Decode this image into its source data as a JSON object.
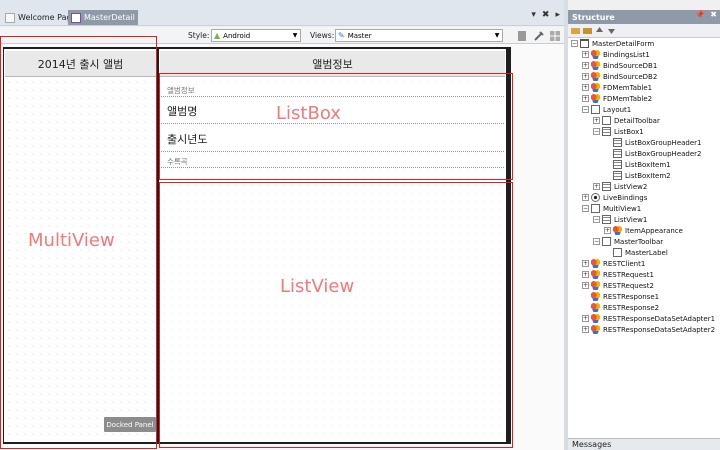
{
  "tabs": [
    {
      "label": "Welcome Page",
      "icon": "page-icon",
      "active": false
    },
    {
      "label": "MasterDetail",
      "icon": "form-icon",
      "active": true
    }
  ],
  "window_controls": {
    "dropdown": "▾",
    "close": "✖",
    "menu": "▸"
  },
  "toolbar": {
    "style_label": "Style:",
    "style_value": "Android",
    "views_label": "Views:",
    "views_value": "Master"
  },
  "form": {
    "master_title": "2014년 출시 앨범",
    "detail_title": "앨범정보",
    "listbox_rows": [
      "앨범정보",
      "앨범명",
      "출시년도",
      "수록곡"
    ],
    "docked_panel": "Docked Panel"
  },
  "annotations": {
    "multiview": "MultiView",
    "listbox": "ListBox",
    "listview": "ListView"
  },
  "structure": {
    "title": "Structure",
    "pin": "📌",
    "close": "✖",
    "nodes": [
      {
        "label": "MasterDetailForm",
        "depth": 0,
        "exp": "−",
        "icon": "form"
      },
      {
        "label": "BindingsList1",
        "depth": 1,
        "exp": "+",
        "icon": "comp"
      },
      {
        "label": "BindSourceDB1",
        "depth": 1,
        "exp": "+",
        "icon": "comp"
      },
      {
        "label": "BindSourceDB2",
        "depth": 1,
        "exp": "+",
        "icon": "comp"
      },
      {
        "label": "FDMemTable1",
        "depth": 1,
        "exp": "+",
        "icon": "comp"
      },
      {
        "label": "FDMemTable2",
        "depth": 1,
        "exp": "+",
        "icon": "comp"
      },
      {
        "label": "Layout1",
        "depth": 1,
        "exp": "−",
        "icon": "panel"
      },
      {
        "label": "DetailToolbar",
        "depth": 2,
        "exp": "+",
        "icon": "panel"
      },
      {
        "label": "ListBox1",
        "depth": 2,
        "exp": "−",
        "icon": "grid"
      },
      {
        "label": "ListBoxGroupHeader1",
        "depth": 3,
        "exp": "",
        "icon": "grid"
      },
      {
        "label": "ListBoxGroupHeader2",
        "depth": 3,
        "exp": "",
        "icon": "grid"
      },
      {
        "label": "ListBoxItem1",
        "depth": 3,
        "exp": "",
        "icon": "grid"
      },
      {
        "label": "ListBoxItem2",
        "depth": 3,
        "exp": "",
        "icon": "grid"
      },
      {
        "label": "ListView2",
        "depth": 2,
        "exp": "+",
        "icon": "grid"
      },
      {
        "label": "LiveBindings",
        "depth": 1,
        "exp": "+",
        "icon": "bind"
      },
      {
        "label": "MultiView1",
        "depth": 1,
        "exp": "−",
        "icon": "panel"
      },
      {
        "label": "ListView1",
        "depth": 2,
        "exp": "−",
        "icon": "grid"
      },
      {
        "label": "ItemAppearance",
        "depth": 3,
        "exp": "+",
        "icon": "comp"
      },
      {
        "label": "MasterToolbar",
        "depth": 2,
        "exp": "−",
        "icon": "panel"
      },
      {
        "label": "MasterLabel",
        "depth": 3,
        "exp": "",
        "icon": "item"
      },
      {
        "label": "RESTClient1",
        "depth": 1,
        "exp": "+",
        "icon": "comp"
      },
      {
        "label": "RESTRequest1",
        "depth": 1,
        "exp": "+",
        "icon": "comp"
      },
      {
        "label": "RESTRequest2",
        "depth": 1,
        "exp": "+",
        "icon": "comp"
      },
      {
        "label": "RESTResponse1",
        "depth": 1,
        "exp": "",
        "icon": "comp"
      },
      {
        "label": "RESTResponse2",
        "depth": 1,
        "exp": "",
        "icon": "comp"
      },
      {
        "label": "RESTResponseDataSetAdapter1",
        "depth": 1,
        "exp": "+",
        "icon": "comp"
      },
      {
        "label": "RESTResponseDataSetAdapter2",
        "depth": 1,
        "exp": "+",
        "icon": "comp"
      }
    ]
  },
  "messages_label": "Messages"
}
